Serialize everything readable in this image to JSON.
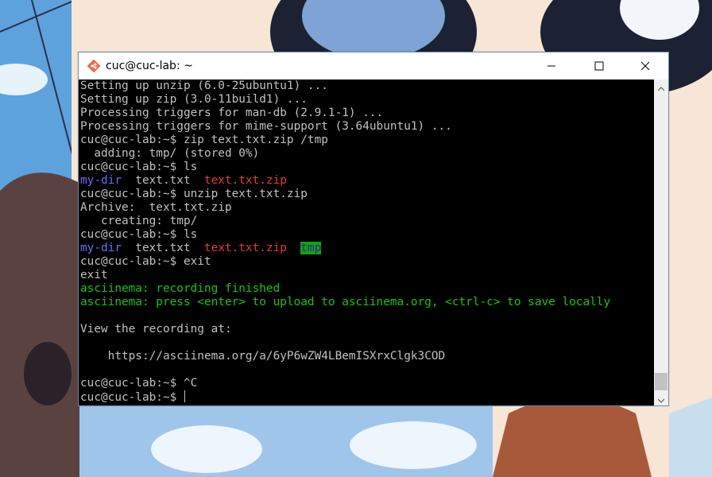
{
  "window": {
    "title": "cuc@cuc-lab: ~",
    "app_icon": "git-bash-icon",
    "controls": {
      "minimize_icon": "minimize-icon",
      "maximize_icon": "maximize-icon",
      "close_icon": "close-icon"
    }
  },
  "terminal": {
    "lines": [
      [
        {
          "text": "Setting up unzip (6.0-25ubuntu1) ...",
          "color": "default"
        }
      ],
      [
        {
          "text": "Setting up zip (3.0-11build1) ...",
          "color": "default"
        }
      ],
      [
        {
          "text": "Processing triggers for man-db (2.9.1-1) ...",
          "color": "default"
        }
      ],
      [
        {
          "text": "Processing triggers for mime-support (3.64ubuntu1) ...",
          "color": "default"
        }
      ],
      [
        {
          "text": "cuc@cuc-lab:~$ zip text.txt.zip /tmp",
          "color": "default"
        }
      ],
      [
        {
          "text": "  adding: tmp/ (stored 0%)",
          "color": "default"
        }
      ],
      [
        {
          "text": "cuc@cuc-lab:~$ ls",
          "color": "default"
        }
      ],
      [
        {
          "text": "my-dir",
          "color": "blue"
        },
        {
          "text": "  text.txt  ",
          "color": "default"
        },
        {
          "text": "text.txt.zip",
          "color": "red"
        }
      ],
      [
        {
          "text": "cuc@cuc-lab:~$ unzip text.txt.zip",
          "color": "default"
        }
      ],
      [
        {
          "text": "Archive:  text.txt.zip",
          "color": "default"
        }
      ],
      [
        {
          "text": "   creating: tmp/",
          "color": "default"
        }
      ],
      [
        {
          "text": "cuc@cuc-lab:~$ ls",
          "color": "default"
        }
      ],
      [
        {
          "text": "my-dir",
          "color": "blue"
        },
        {
          "text": "  text.txt  ",
          "color": "default"
        },
        {
          "text": "text.txt.zip",
          "color": "red"
        },
        {
          "text": "  ",
          "color": "default"
        },
        {
          "text": "tmp",
          "color": "tmp"
        }
      ],
      [
        {
          "text": "cuc@cuc-lab:~$ exit",
          "color": "default"
        }
      ],
      [
        {
          "text": "exit",
          "color": "default"
        }
      ],
      [
        {
          "text": "asciinema: recording finished",
          "color": "green"
        }
      ],
      [
        {
          "text": "asciinema: press <enter> to upload to asciinema.org, <ctrl-c> to save locally",
          "color": "green"
        }
      ],
      [
        {
          "text": "",
          "color": "default"
        }
      ],
      [
        {
          "text": "View the recording at:",
          "color": "default"
        }
      ],
      [
        {
          "text": "",
          "color": "default"
        }
      ],
      [
        {
          "text": "    https://asciinema.org/a/6yP6wZW4LBemISXrxClgk3COD",
          "color": "default"
        }
      ],
      [
        {
          "text": "",
          "color": "default"
        }
      ],
      [
        {
          "text": "cuc@cuc-lab:~$ ^C",
          "color": "default"
        }
      ],
      [
        {
          "text": "cuc@cuc-lab:~$ ",
          "color": "default",
          "cursor": true
        }
      ]
    ]
  },
  "scrollbar": {
    "up_icon": "scroll-up-arrow-icon",
    "down_icon": "scroll-down-arrow-icon",
    "position_fraction": 0.97
  },
  "colors": {
    "default": "#c0c0c0",
    "blue": "#6b6bff",
    "red": "#e53b3b",
    "green": "#16c60c",
    "tmp_bg": "#13a10e",
    "tmp_fg": "#2a2aa0",
    "terminal_bg": "#000000"
  }
}
